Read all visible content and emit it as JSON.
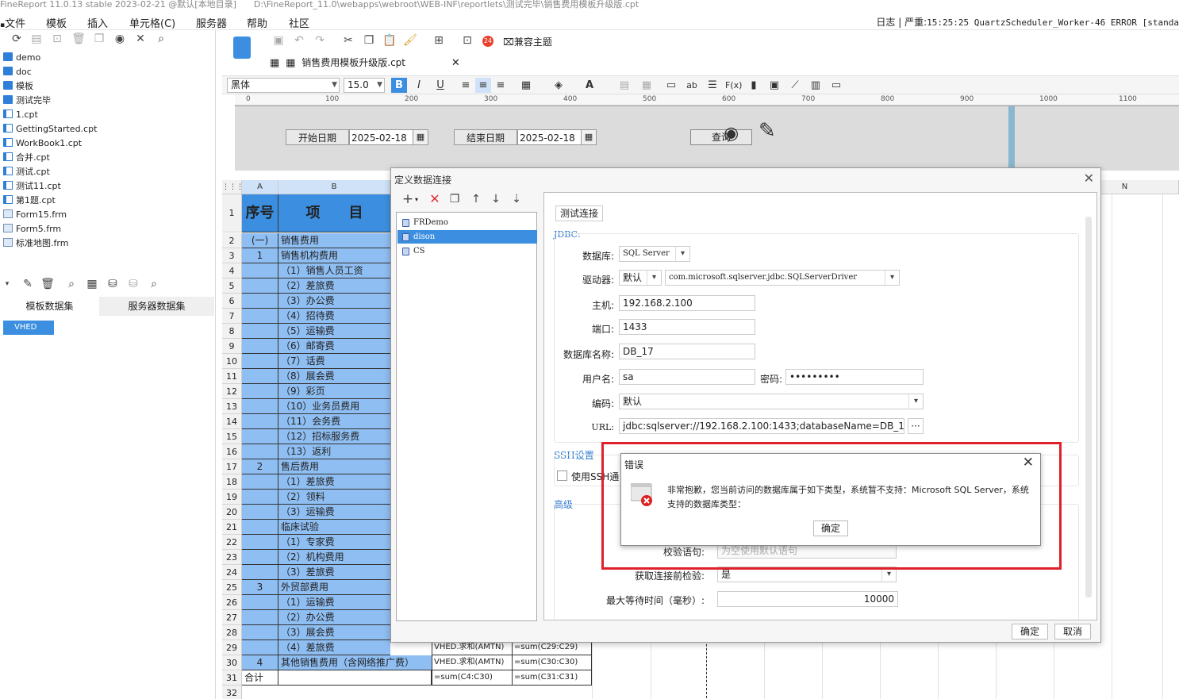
{
  "titlebar": {
    "app": "FineReport 11.0.13 stable 2023-02-21 @默认[本地目录]",
    "path": "D:\\FineReport_11.0\\webapps\\webroot\\WEB-INF\\reportlets\\测试完毕\\销售费用模板升级版.cpt"
  },
  "menu": {
    "items": [
      "文件",
      "模板",
      "插入",
      "单元格(C)",
      "服务器",
      "帮助",
      "社区"
    ],
    "log_label": "日志",
    "log_level": "严重:",
    "log_text": "15:25:25 QuartzScheduler_Worker-46 ERROR [standa"
  },
  "tree": {
    "items": [
      {
        "label": "demo",
        "type": "folder"
      },
      {
        "label": "doc",
        "type": "folder"
      },
      {
        "label": "模板",
        "type": "folder"
      },
      {
        "label": "测试完毕",
        "type": "folder"
      },
      {
        "label": "1.cpt",
        "type": "file"
      },
      {
        "label": "GettingStarted.cpt",
        "type": "file"
      },
      {
        "label": "WorkBook1.cpt",
        "type": "file"
      },
      {
        "label": "合并.cpt",
        "type": "file"
      },
      {
        "label": "测试.cpt",
        "type": "file"
      },
      {
        "label": "测试11.cpt",
        "type": "file"
      },
      {
        "label": "第1题.cpt",
        "type": "file"
      },
      {
        "label": "Form15.frm",
        "type": "form"
      },
      {
        "label": "Form5.frm",
        "type": "form"
      },
      {
        "label": "标准地图.frm",
        "type": "form"
      }
    ]
  },
  "datasets": {
    "tabs": [
      "模板数据集",
      "服务器数据集"
    ],
    "item": "VHED"
  },
  "toolbar": {
    "compat_theme": "兼容主题",
    "badge": "24"
  },
  "file_tab": {
    "label": "销售费用模板升级版.cpt"
  },
  "format": {
    "font": "黑体",
    "size": "15.0"
  },
  "ruler": {
    "ticks": [
      "0",
      "100",
      "200",
      "300",
      "400",
      "500",
      "600",
      "700",
      "800",
      "900",
      "1000",
      "1100"
    ]
  },
  "params": {
    "start_label": "开始日期",
    "start_value": "2025-02-18",
    "end_label": "结束日期",
    "end_value": "2025-02-18",
    "query": "查询"
  },
  "sheet": {
    "col_a": "A",
    "col_b": "B",
    "col_n": "N",
    "header_a": "序号",
    "header_b": "项　　目",
    "rows": [
      {
        "n": "2",
        "a": "(一)",
        "b": "销售费用"
      },
      {
        "n": "3",
        "a": "1",
        "b": "销售机构费用"
      },
      {
        "n": "4",
        "a": "",
        "b": "（1）销售人员工资"
      },
      {
        "n": "5",
        "a": "",
        "b": "（2）差旅费"
      },
      {
        "n": "6",
        "a": "",
        "b": "（3）办公费"
      },
      {
        "n": "7",
        "a": "",
        "b": "（4）招待费"
      },
      {
        "n": "8",
        "a": "",
        "b": "（5）运输费"
      },
      {
        "n": "9",
        "a": "",
        "b": "（6）邮寄费"
      },
      {
        "n": "10",
        "a": "",
        "b": "（7）话费"
      },
      {
        "n": "11",
        "a": "",
        "b": "（8）展会费"
      },
      {
        "n": "12",
        "a": "",
        "b": "（9）彩页"
      },
      {
        "n": "13",
        "a": "",
        "b": "（10）业务员费用"
      },
      {
        "n": "14",
        "a": "",
        "b": "（11）会务费"
      },
      {
        "n": "15",
        "a": "",
        "b": "（12）招标服务费"
      },
      {
        "n": "16",
        "a": "",
        "b": "（13）返利"
      },
      {
        "n": "17",
        "a": "2",
        "b": "售后费用"
      },
      {
        "n": "18",
        "a": "",
        "b": "（1）差旅费"
      },
      {
        "n": "19",
        "a": "",
        "b": "（2）领料"
      },
      {
        "n": "20",
        "a": "",
        "b": "（3）运输费"
      },
      {
        "n": "21",
        "a": "",
        "b": "临床试验"
      },
      {
        "n": "22",
        "a": "",
        "b": "（1）专家费"
      },
      {
        "n": "23",
        "a": "",
        "b": "（2）机构费用"
      },
      {
        "n": "24",
        "a": "",
        "b": "（3）差旅费"
      },
      {
        "n": "25",
        "a": "3",
        "b": "外贸部费用"
      },
      {
        "n": "26",
        "a": "",
        "b": "（1）运输费"
      },
      {
        "n": "27",
        "a": "",
        "b": "（2）办公费"
      },
      {
        "n": "28",
        "a": "",
        "b": "（3）展会费"
      },
      {
        "n": "29",
        "a": "",
        "b": "（4）差旅费",
        "c": "VHED.求和(AMTN)",
        "d": "=sum(C29:C29)"
      },
      {
        "n": "30",
        "a": "4",
        "b": "其他销售费用（含网络推广费）",
        "c": "VHED.求和(AMTN)",
        "d": "=sum(C30:C30)"
      },
      {
        "n": "31",
        "a": "合计",
        "b": "",
        "c": "=sum(C4:C30)",
        "d": "=sum(C31:C31)"
      },
      {
        "n": "32",
        "a": "",
        "b": ""
      }
    ]
  },
  "conn_dialog": {
    "title": "定义数据连接",
    "connections": [
      "FRDemo",
      "dison",
      "CS"
    ],
    "selected_index": 1,
    "test_button": "测试连接",
    "jdbc_section": "JDBC:",
    "db_label": "数据库:",
    "db_value": "SQL Server",
    "driver_label": "驱动器:",
    "driver_mode": "默认",
    "driver_value": "com.microsoft.sqlserver.jdbc.SQLServerDriver",
    "host_label": "主机:",
    "host_value": "192.168.2.100",
    "port_label": "端口:",
    "port_value": "1433",
    "dbname_label": "数据库名称:",
    "dbname_value": "DB_17",
    "user_label": "用户名:",
    "user_value": "sa",
    "pwd_label": "密码:",
    "pwd_value": "•••••••••",
    "encoding_label": "编码:",
    "encoding_value": "默认",
    "url_label": "URL:",
    "url_value": "jdbc:sqlserver://192.168.2.100:1433;databaseName=DB_17",
    "url_more": "···",
    "ssh_section": "SSH设置",
    "use_ssh": "使用SSH通",
    "advanced_section": "高级",
    "validate_label": "校验语句:",
    "validate_placeholder": "为空使用默认语句",
    "check_label": "获取连接前检验:",
    "check_value": "是",
    "wait_label": "最大等待时间（毫秒）:",
    "wait_value": "10000",
    "ok": "确定",
    "cancel": "取消"
  },
  "error_dialog": {
    "title": "错误",
    "message": "非常抱歉，您当前访问的数据库属于如下类型，系统暂不支持：Microsoft SQL Server，系统支持的数据库类型：",
    "ok": "确定",
    "frame_color": "#e0202a"
  },
  "colors": {
    "accent": "#3c8fe0",
    "cell_blue": "#8fbef2",
    "section_blue": "#2d7bd1"
  }
}
